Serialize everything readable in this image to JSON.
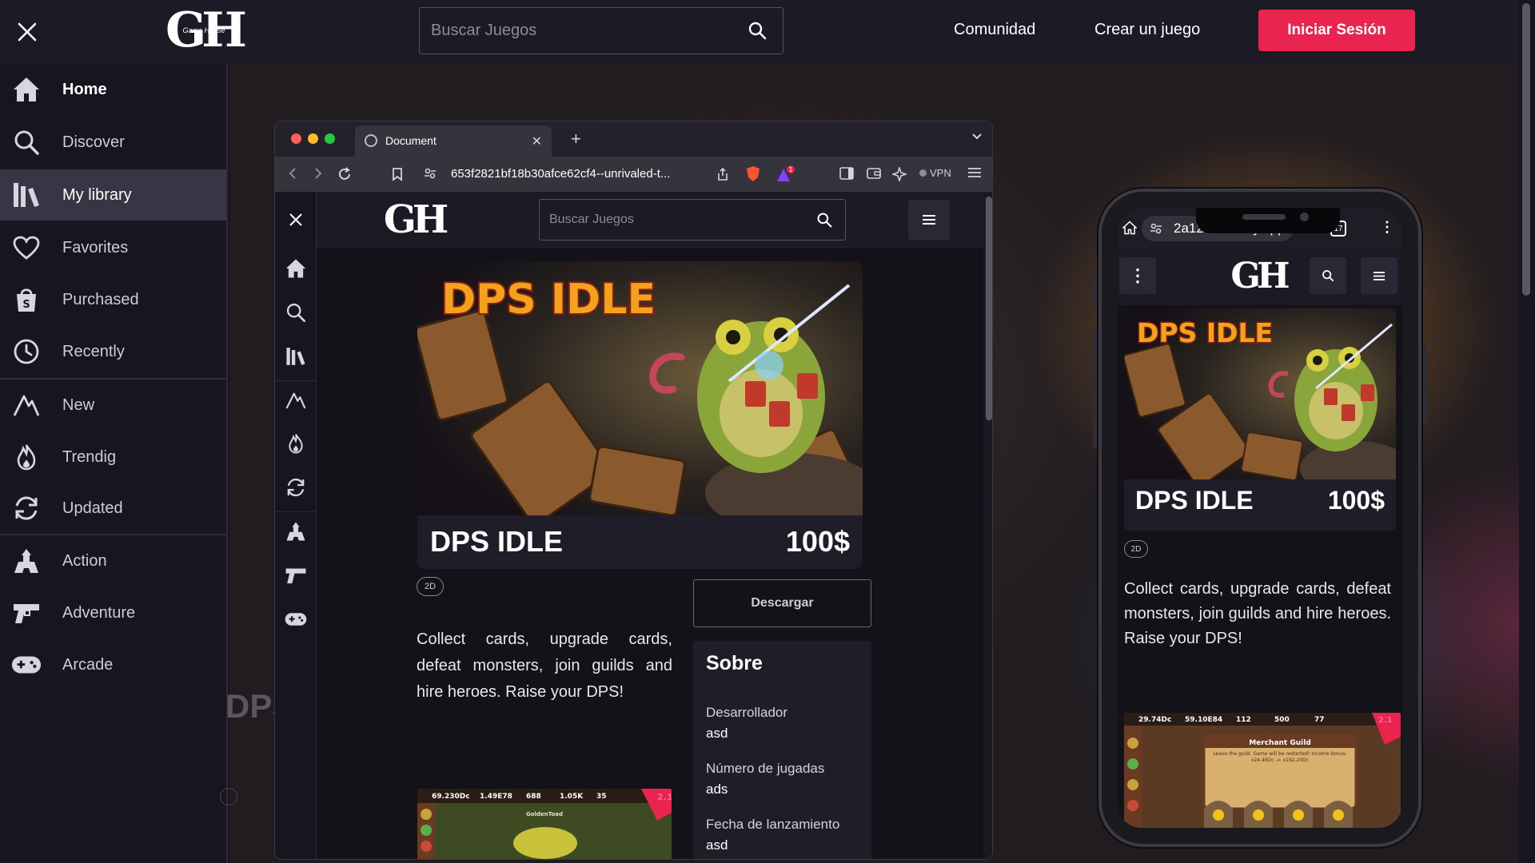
{
  "app": {
    "logo_text": "GH",
    "logo_sub": "Game House"
  },
  "header": {
    "search_placeholder": "Buscar Juegos",
    "links": [
      "Comunidad",
      "Crear un juego"
    ],
    "login_label": "Iniciar Sesión"
  },
  "sidebar": {
    "items": [
      {
        "label": "Home",
        "icon": "home-icon"
      },
      {
        "label": "Discover",
        "icon": "search-icon"
      },
      {
        "label": "My library",
        "icon": "library-icon"
      },
      {
        "label": "Favorites",
        "icon": "heart-icon"
      },
      {
        "label": "Purchased",
        "icon": "shopping-bag-icon"
      },
      {
        "label": "Recently",
        "icon": "clock-icon"
      },
      {
        "label": "New",
        "icon": "new-icon"
      },
      {
        "label": "Trendig",
        "icon": "flame-icon"
      },
      {
        "label": "Updated",
        "icon": "refresh-icon"
      },
      {
        "label": "Action",
        "icon": "action-icon"
      },
      {
        "label": "Adventure",
        "icon": "gun-icon"
      },
      {
        "label": "Arcade",
        "icon": "gamepad-icon"
      }
    ]
  },
  "background": {
    "partial_title": "DPS"
  },
  "browser": {
    "tab_title": "Document",
    "url": "653f2821bf18b30afce62cf4--unrivaled-t...",
    "vpn_label": "VPN",
    "notification_count": "1"
  },
  "game": {
    "title": "DPS IDLE",
    "art_title": "DPS IDLE",
    "price": "100$",
    "tag": "2D",
    "description": "Collect cards, upgrade cards, defeat monsters, join guilds and hire heroes. Raise your DPS!",
    "download_label": "Descargar",
    "about": {
      "heading": "Sobre",
      "developer_label": "Desarrollador",
      "developer_value": "asd",
      "plays_label": "Número de jugadas",
      "plays_value": "ads",
      "release_label": "Fecha de lanzamiento",
      "release_value": "asd"
    },
    "screenshot_desktop": {
      "stats": [
        "69.230Dc",
        "1.49E78",
        "688",
        "1.05K",
        "35"
      ],
      "caption": "GoldenToad",
      "badge": "2.1"
    },
    "screenshot_mobile": {
      "stats": [
        "29.74Dc",
        "59.10E84",
        "112",
        "500",
        "77"
      ],
      "panel_title": "Merchant Guild",
      "panel_text": "Leave the guild. Game will be restarted! Income bonus: x24.46Dc -> x192.20Dc",
      "badge": "2.1"
    }
  },
  "phone": {
    "url": "2a12Se.netlify.app",
    "tab_count": "17"
  },
  "colors": {
    "accent": "#e8244f",
    "sidebar_active": "#3a3545",
    "background": "#17151f"
  }
}
